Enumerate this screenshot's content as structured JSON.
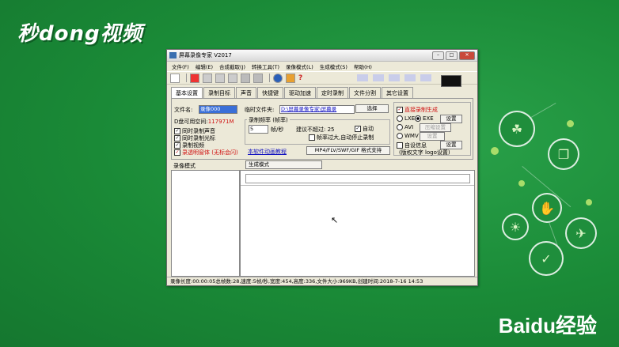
{
  "brand": {
    "logo_text": "秒dong视频",
    "watermark": "Baidu经验"
  },
  "window": {
    "title": "屏幕录像专家 V2017",
    "menu": [
      "文件(F)",
      "编辑(E)",
      "合成截取(J)",
      "转换工具(T)",
      "录像模式(L)",
      "生成模式(S)",
      "帮助(H)"
    ],
    "tabs": [
      "基本设置",
      "录制目标",
      "声音",
      "快捷键",
      "驱动加速",
      "定时录制",
      "文件分割",
      "其它设置"
    ],
    "active_tab": "基本设置"
  },
  "basic": {
    "filename_label": "文件名:",
    "filename_value": "录像000",
    "temp_folder_label": "临时文件夹:",
    "temp_folder_value": "D:\\屏幕录像专家\\屏幕录",
    "select_button": "选择",
    "disk_space_label": "D盘可用空间:",
    "disk_space_value": "117971M",
    "checkboxes": [
      {
        "label": "同时录制声音",
        "checked": true
      },
      {
        "label": "同时录制光标",
        "checked": true
      },
      {
        "label": "录制视频",
        "checked": true
      },
      {
        "label": "录透明窗体 (无标会闪)",
        "checked": true
      }
    ],
    "freq_group_label": "录制频率 (帧率)",
    "fps_value": "5",
    "fps_unit": "帧/秒",
    "suggest_label": "建议不超过: 25",
    "auto_label": "自动",
    "auto_checked": true,
    "auto_stop_label": "帧率过大,自动停止录制",
    "auto_stop_checked": false,
    "tutorial_link": "本软件动画教程",
    "format_button": "MP4/FLV/SWF/GIF 格式支持",
    "direct_gen_label": "直接录制生成",
    "direct_gen_checked": true,
    "formats": [
      "LXE",
      "EXE",
      "AVI",
      "WMV"
    ],
    "selected_format": "EXE",
    "settings_button": "设置",
    "compress_button": "压缩设置",
    "settings_button_2": "设置",
    "auto_info_label": "自设信息",
    "settings_button_3": "设置",
    "version_text": "(版权文字 logo设置)"
  },
  "panels": {
    "left_header": "录像模式",
    "right_header": "生成模式"
  },
  "status": "录像长度:00:00:05总帧数:28,速度:5帧/秒,宽度:454,高度:336,文件大小:969KB,创建时间:2018-7-16 14:53"
}
